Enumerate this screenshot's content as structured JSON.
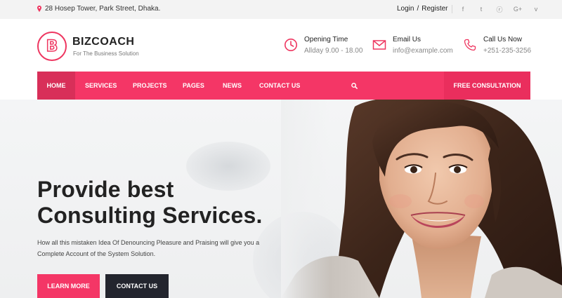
{
  "topbar": {
    "address": "28 Hosep Tower, Park Street, Dhaka.",
    "login": "Login",
    "separator": "/",
    "register": "Register",
    "social": [
      {
        "icon": "facebook-icon",
        "glyph": "f"
      },
      {
        "icon": "twitter-icon",
        "glyph": "t"
      },
      {
        "icon": "rss-icon",
        "glyph": "ⓡ"
      },
      {
        "icon": "google-plus-icon",
        "glyph": "G+"
      },
      {
        "icon": "vimeo-icon",
        "glyph": "v"
      }
    ]
  },
  "header": {
    "logo_letter": "B",
    "brand": "BIZCOACH",
    "tagline": "For The Business Solution",
    "opening": {
      "title": "Opening Time",
      "value": "Allday 9.00 - 18.00",
      "icon": "clock-icon"
    },
    "email": {
      "title": "Email Us",
      "value": "info@example.com",
      "icon": "envelope-icon"
    },
    "call": {
      "title": "Call Us Now",
      "value": "+251-235-3256",
      "icon": "phone-icon"
    }
  },
  "nav": {
    "items": [
      "HOME",
      "SERVICES",
      "PROJECTS",
      "PAGES",
      "NEWS",
      "CONTACT US"
    ],
    "search_icon": "search-icon",
    "cta": "FREE CONSULTATION"
  },
  "hero": {
    "headline_line1": "Provide best",
    "headline_line2": "Consulting Services.",
    "description": "How all this mistaken Idea Of Denouncing Pleasure and Praising will give you a Complete Account of the System Solution.",
    "learn_more": "LEARN MORE",
    "contact_us": "CONTACT US"
  },
  "colors": {
    "accent": "#f43666",
    "accent_dark": "#d82f59",
    "dark_button": "#23252e"
  }
}
